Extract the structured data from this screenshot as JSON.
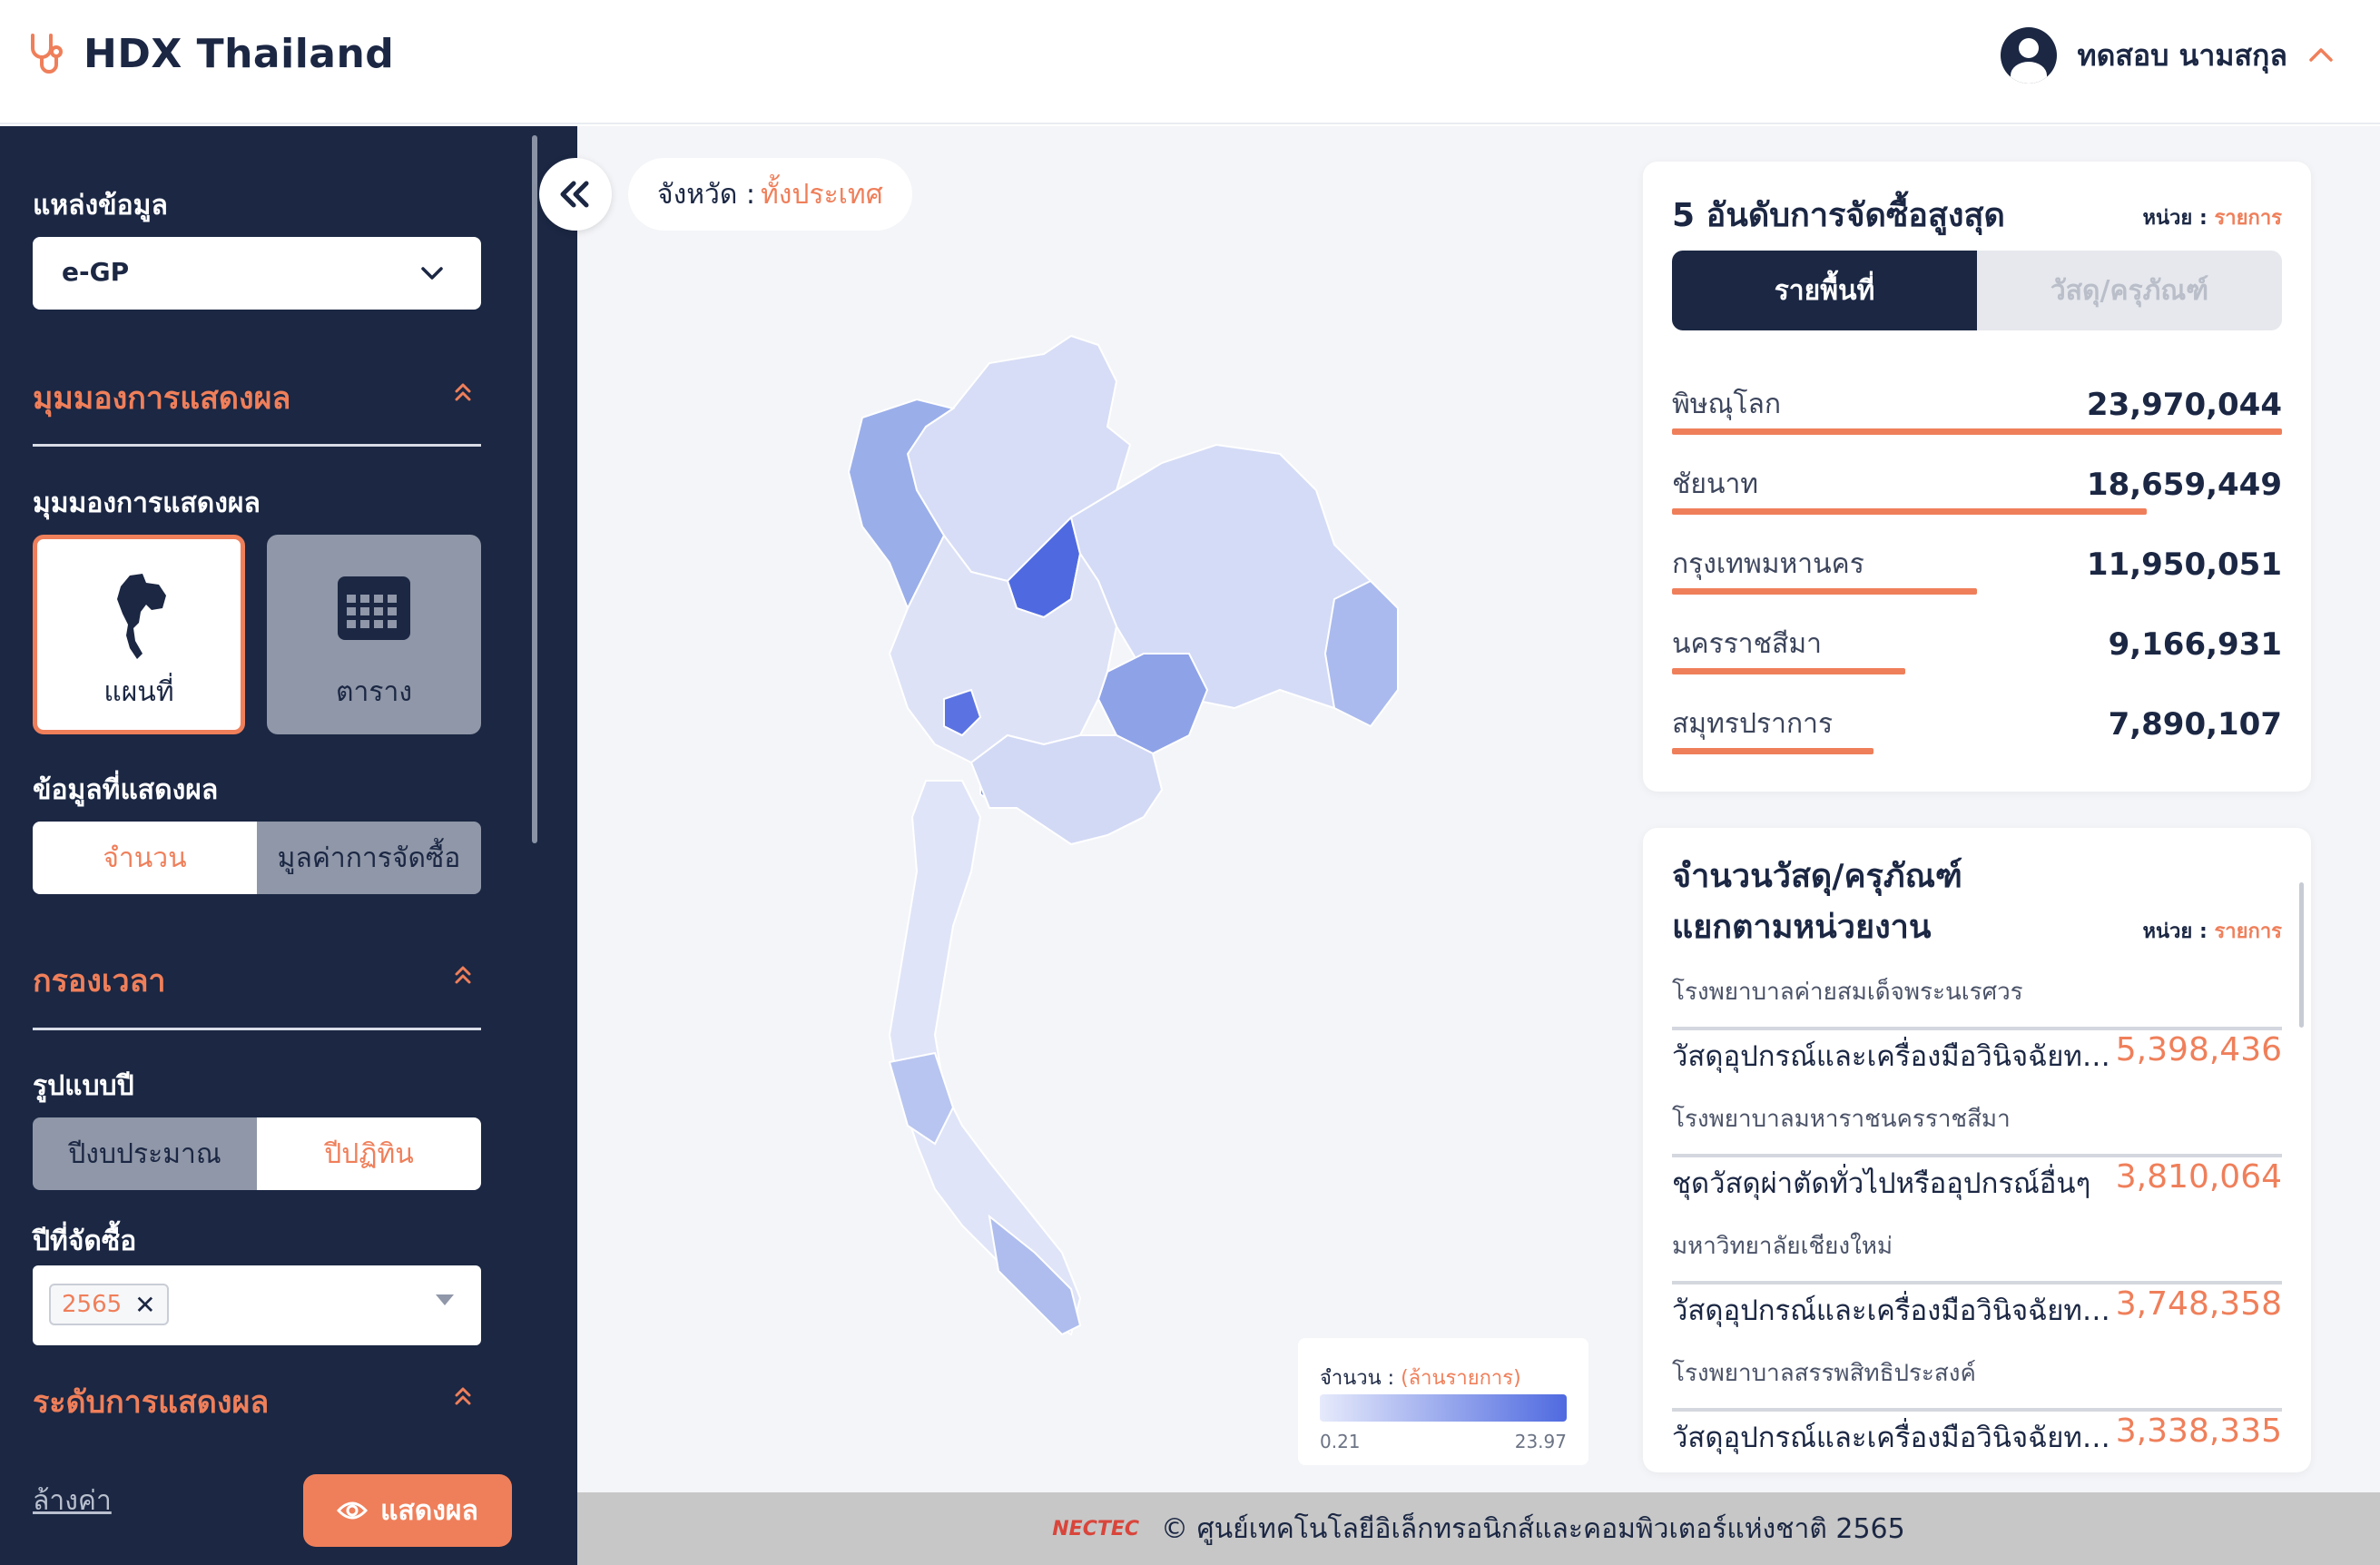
{
  "header": {
    "app_title": "HDX Thailand",
    "user_name": "ทดสอบ นามสกุล"
  },
  "sidebar": {
    "source_label": "แหล่งข้อมูล",
    "source_value": "e-GP",
    "view_section": "มุมมองการแสดงผล",
    "view_label": "มุมมองการแสดงผล",
    "view_options": [
      {
        "label": "แผนที่",
        "selected": true,
        "icon": "thailand-map-icon"
      },
      {
        "label": "ตาราง",
        "selected": false,
        "icon": "calendar-grid-icon"
      }
    ],
    "data_label": "ข้อมูลที่แสดงผล",
    "data_options": [
      {
        "label": "จำนวน",
        "selected": true
      },
      {
        "label": "มูลค่าการจัดซื้อ",
        "selected": false
      }
    ],
    "time_section": "กรองเวลา",
    "year_type_label": "รูปแบบปี",
    "year_type_options": [
      {
        "label": "ปีงบประมาณ",
        "selected": false
      },
      {
        "label": "ปีปฏิทิน",
        "selected": true
      }
    ],
    "purchase_year_label": "ปีที่จัดซื้อ",
    "purchase_year_chip": "2565",
    "level_section": "ระดับการแสดงผล",
    "reset_label": "ล้างค่า",
    "show_label": "แสดงผล"
  },
  "map": {
    "province_label": "จังหวัด :",
    "province_value": "ทั้งประเทศ",
    "legend_title": "จำนวน :",
    "legend_unit": "(ล้านรายการ)",
    "legend_min": "0.21",
    "legend_max": "23.97",
    "color_low": "#e6eafb",
    "color_high": "#4f6ae0"
  },
  "top5": {
    "title": "5 อันดับการจัดซื้อสูงสุด",
    "unit_label": "หน่วย :",
    "unit_value": "รายการ",
    "tabs": [
      "รายพื้นที่",
      "วัสดุ/ครุภัณฑ์"
    ],
    "rows": [
      {
        "name": "พิษณุโลก",
        "value": "23,970,044",
        "fraction": 1.0
      },
      {
        "name": "ชัยนาท",
        "value": "18,659,449",
        "fraction": 0.778
      },
      {
        "name": "กรุงเทพมหานคร",
        "value": "11,950,051",
        "fraction": 0.5
      },
      {
        "name": "นครราชสีมา",
        "value": "9,166,931",
        "fraction": 0.383
      },
      {
        "name": "สมุทรปราการ",
        "value": "7,890,107",
        "fraction": 0.33
      }
    ]
  },
  "by_unit": {
    "title_line1": "จำนวนวัสดุ/ครุภัณฑ์",
    "title_line2": "แยกตามหน่วยงาน",
    "unit_label": "หน่วย :",
    "unit_value": "รายการ",
    "entries": [
      {
        "dept": "โรงพยาบาลค่ายสมเด็จพระนเรศวร",
        "item": "วัสดุอุปกรณ์และเครื่องมือวินิจฉัยทางการแพทย์",
        "value": "5,398,436"
      },
      {
        "dept": "โรงพยาบาลมหาราชนครราชสีมา",
        "item": "ชุดวัสดุผ่าตัดทั่วไปหรืออุปกรณ์อื่นๆ",
        "value": "3,810,064"
      },
      {
        "dept": "มหาวิทยาลัยเชียงใหม่",
        "item": "วัสดุอุปกรณ์และเครื่องมือวินิจฉัยทางการแพทย์",
        "value": "3,748,358"
      },
      {
        "dept": "โรงพยาบาลสรรพสิทธิประสงค์",
        "item": "วัสดุอุปกรณ์และเครื่องมือวินิจฉัยทางการแพทย์",
        "value": "3,338,335"
      }
    ]
  },
  "footer": {
    "org_logo": "NECTEC",
    "copyright": "© ศูนย์เทคโนโลยีอิเล็กทรอนิกส์และคอมพิวเตอร์แห่งชาติ 2565"
  },
  "colors": {
    "navy": "#1b2743",
    "accent": "#ef7f5a"
  }
}
